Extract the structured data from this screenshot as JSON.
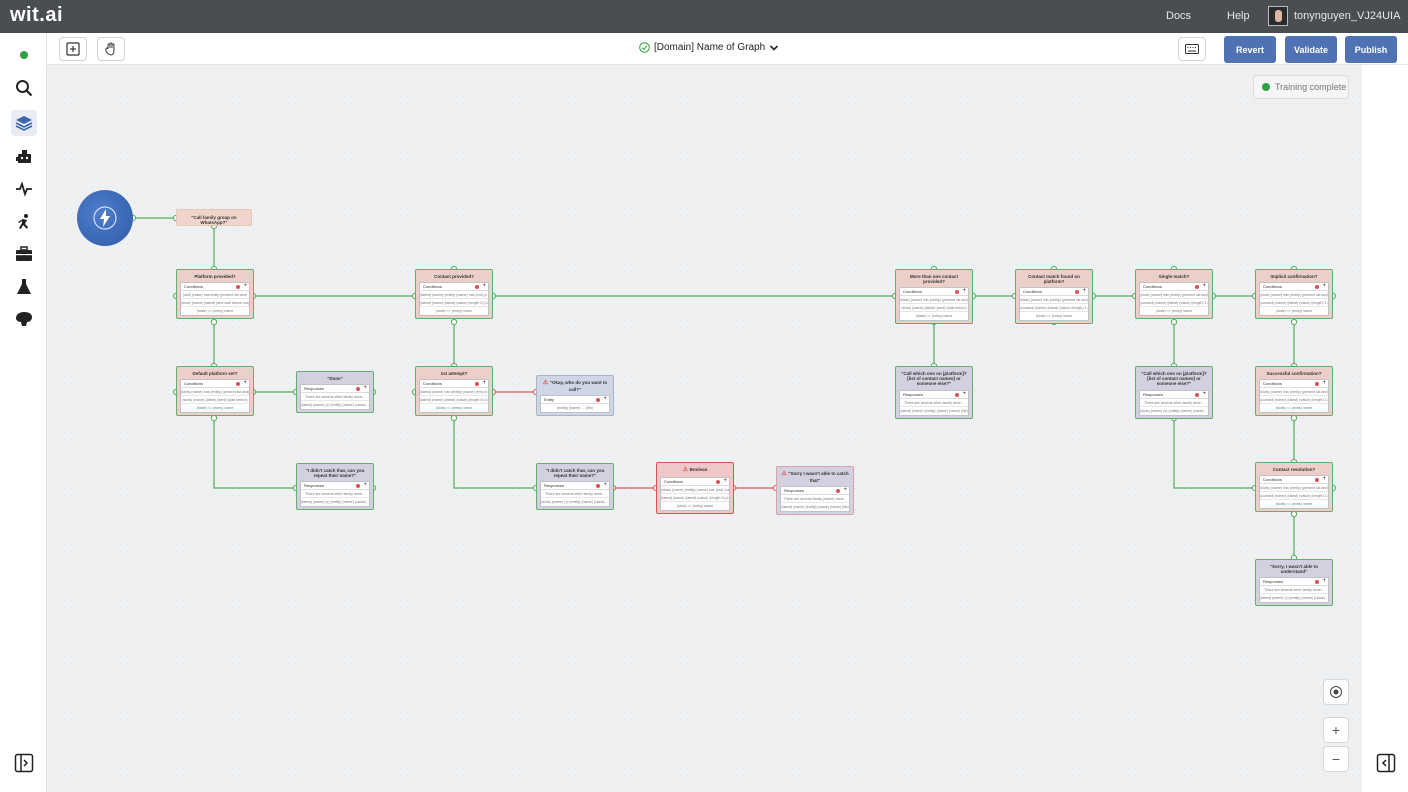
{
  "app": {
    "logo": "wit.ai",
    "docs_label": "Docs",
    "help_label": "Help",
    "username": "tonynguyen_VJ24UIA"
  },
  "sidebar": {
    "items": [
      "status-dot",
      "search-icon",
      "layers-icon",
      "bot-icon",
      "activity-icon",
      "runner-icon",
      "briefcase-icon",
      "flask-icon",
      "brain-icon"
    ],
    "collapse_icon": "panel-toggle-icon"
  },
  "toolbar": {
    "graph_name": "[Domain] Name of Graph",
    "revert_label": "Revert",
    "validate_label": "Validate",
    "publish_label": "Publish"
  },
  "canvas": {
    "training_status": "Training complete",
    "zoom_in": "+",
    "zoom_out": "−"
  },
  "nodes": {
    "trigger": {
      "title": "\"Call family group on WhatsApp?\""
    },
    "platform_provided": {
      "title": "Platform provided?",
      "card": "Conditions",
      "rows": [
        "[slot] (value) has entity (present list and)",
        "(slots) (name) (latest) (and wait before out)",
        "(state) == (entry) name"
      ]
    },
    "contact_provided": {
      "title": "Contact provided?",
      "card": "Conditions",
      "rows": [
        "(latest) (name) (entity) (name) has (ent) (v...)",
        "(latest) (name) (latest) (value) (length 0) (c...)",
        "(slots) == (entry) name"
      ]
    },
    "more_than_one": {
      "title": "More than one contact provided?",
      "card": "Conditions",
      "rows": [
        "(slots) (name) has (entity) (present list and)",
        "(slots) (name) (latest) (sent) (wait before)",
        "(state) == (entry) name"
      ]
    },
    "contact_match": {
      "title": "Contact match found on platform?",
      "card": "Conditions",
      "rows": [
        "(slots) (name) has (entity) (present list and)",
        "(contact) (name) (latest) (value) (length) 1 (c...)",
        "(slots) == (entry) name"
      ]
    },
    "single_match": {
      "title": "Single match?",
      "card": "Conditions",
      "rows": [
        "(slots) (name) has (entity) (present list and)",
        "(contact) (name) (latest) (value) (length) 1 (...)",
        "(slots) == (entry) name"
      ]
    },
    "implicit_confirmation": {
      "title": "Implicit confirmation?",
      "card": "Conditions",
      "rows": [
        "(slots) (name) has (entity) (present list and)",
        "(contact) (name) (latest) (value) (length) 1 (...)",
        "(slots) == (entry) name"
      ]
    },
    "default_platform": {
      "title": "Default platform set?",
      "card": "Conditions",
      "rows": [
        "[slots] (name) has (entity) (present list and)",
        "(slots) (name) (latest) (sent) (wait before)",
        "(state) == (entry) name"
      ]
    },
    "done": {
      "title": "\"Done\"",
      "card": "Responses",
      "rows": [
        "There are several other family done...",
        "(latest) (name) (v) (entity) (name) (value) ..."
      ]
    },
    "first_attempt": {
      "title": "1st attempt?",
      "card": "Conditions",
      "rows": [
        "(latest) (name) has (entity) (name) (ent) (v...)",
        "(latest) (name) (latest) (value) (length 0) (c...)",
        "(slots) == (entry) name"
      ]
    },
    "okay_who": {
      "title": "\"Okay, who do you want to call?\"",
      "card": "Entity",
      "rows": [
        "(entity) (name) → (list)"
      ]
    },
    "call_which_one": {
      "title": "\"Call which one on [platform]? [list of contact names] or someone else?\"",
      "card": "Responses",
      "rows": [
        "There are several other family done...",
        "(latest) (name) (entity) (name) (value) (list)"
      ]
    },
    "call_which_one_2": {
      "title": "\"Call which one on [platform]? [list of contact names] or someone else?\"",
      "card": "Responses",
      "rows": [
        "There are several other family done...",
        "(slots) (name) (v) (entity) (name) (value) ..."
      ]
    },
    "successful_confirmation": {
      "title": "Successful confirmation?",
      "card": "Conditions",
      "rows": [
        "(slots) (name) has (entity) (present list and)",
        "(contact) (name) (latest) (value) (length) 1 (...)",
        "(slots) == (entry) name"
      ]
    },
    "didnt_catch_1": {
      "title": "\"I didn't catch that, can you repeat their name?\"",
      "card": "Responses",
      "rows": [
        "There are several other family done...",
        "(latest) (name) (v) (entity) (name) (value) ..."
      ]
    },
    "didnt_catch_2": {
      "title": "\"I didn't catch that, can you repeat their name?\"",
      "card": "Responses",
      "rows": [
        "There are several other family done...",
        "(slots) (name) (v) (entity) (name) (value) ..."
      ]
    },
    "boolean": {
      "title": "Boolean",
      "card": "Conditions",
      "rows": [
        "(state) (name) (entity) (name) has (ent) (val...)",
        "(latest) (name) (latest) (value) (length 0) (c...)",
        "(slots) == (entry) name"
      ]
    },
    "sorry_not_able": {
      "title": "\"Sorry I wasn't able to catch that\"",
      "card": "Responses",
      "rows": [
        "There are several family (name) done...",
        "(latest) (name) (entity) (name) (value) (list)"
      ]
    },
    "contact_resolution": {
      "title": "Contact resolution?",
      "card": "Conditions",
      "rows": [
        "(slots) (name) has (entity) (present list and)",
        "(contact) (name) (latest) (value) (length) 1 (...)",
        "(slots) == (entry) name"
      ]
    },
    "sorry_understand": {
      "title": "\"Sorry, I wasn't able to understand\"",
      "card": "Responses",
      "rows": [
        "There are several other family done...",
        "(latest) (name) (v) (entity) (name) (value) ..."
      ]
    }
  }
}
